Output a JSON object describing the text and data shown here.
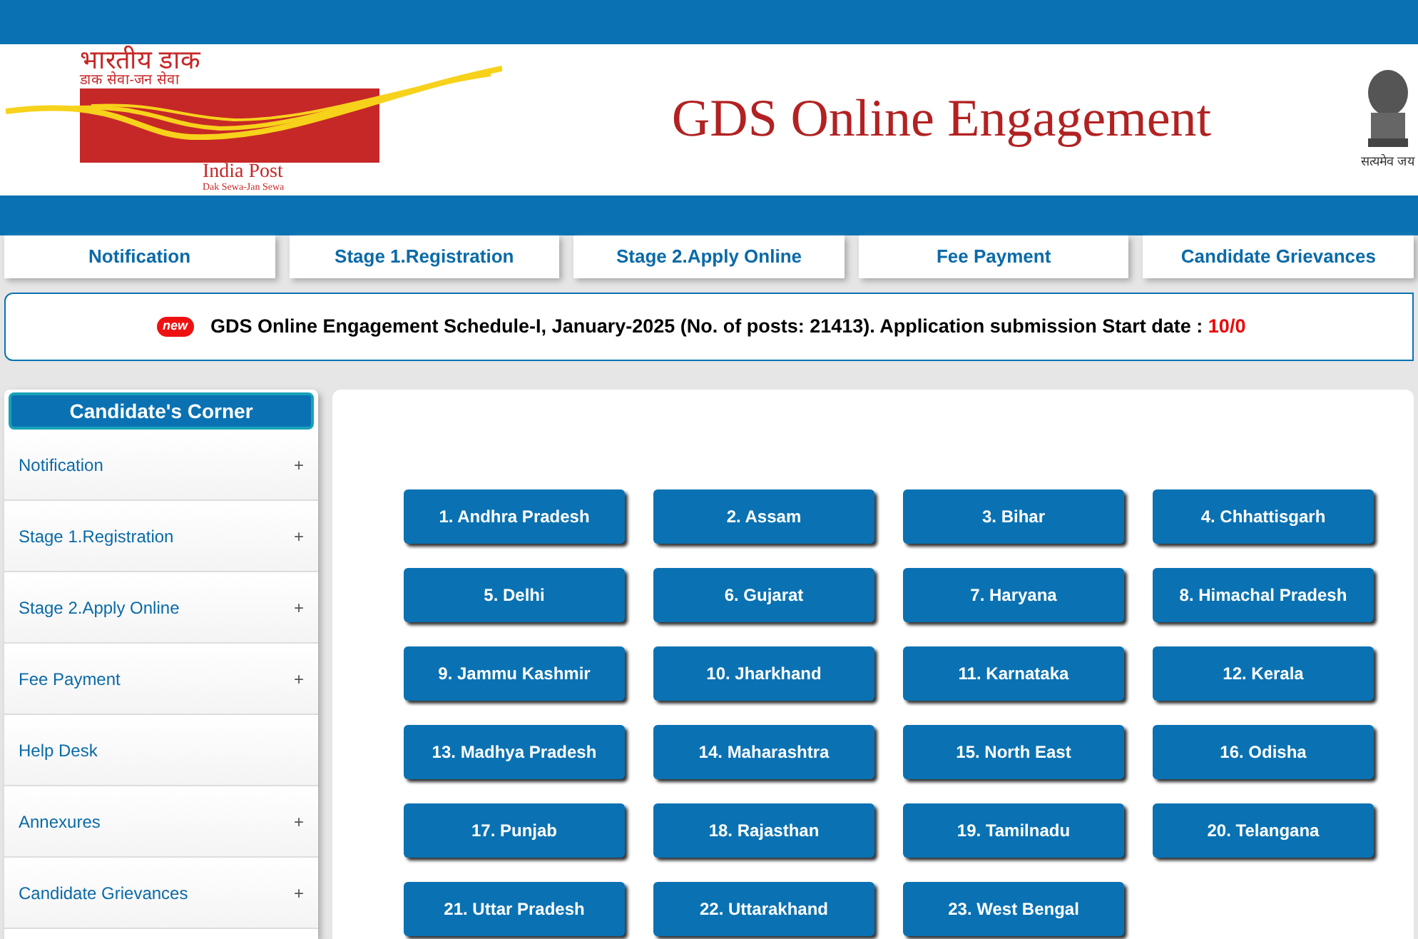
{
  "header": {
    "logo": {
      "hindi_title": "भारतीय डाक",
      "hindi_tagline": "डाक सेवा-जन सेवा",
      "name": "India Post",
      "tagline": "Dak Sewa-Jan Sewa"
    },
    "title": "GDS Online Engagement",
    "emblem_motto": "सत्यमेव जय"
  },
  "nav_tabs": [
    {
      "label": "Notification"
    },
    {
      "label": "Stage 1.Registration"
    },
    {
      "label": "Stage 2.Apply Online"
    },
    {
      "label": "Fee Payment"
    },
    {
      "label": "Candidate Grievances"
    }
  ],
  "ticker": {
    "badge": "new",
    "text": "GDS Online Engagement Schedule-I, January-2025 (No. of posts: 21413). Application submission Start date : ",
    "highlight": "10/0"
  },
  "sidebar": {
    "title": "Candidate's Corner",
    "items": [
      {
        "label": "Notification",
        "expandable": true
      },
      {
        "label": "Stage 1.Registration",
        "expandable": true
      },
      {
        "label": "Stage 2.Apply Online",
        "expandable": true
      },
      {
        "label": "Fee Payment",
        "expandable": true
      },
      {
        "label": "Help Desk",
        "expandable": false
      },
      {
        "label": "Annexures",
        "expandable": true
      },
      {
        "label": "Candidate Grievances",
        "expandable": true
      }
    ],
    "expand_symbol": "+"
  },
  "circles": [
    "1. Andhra Pradesh",
    "2. Assam",
    "3. Bihar",
    "4. Chhattisgarh",
    "5. Delhi",
    "6. Gujarat",
    "7. Haryana",
    "8. Himachal Pradesh",
    "9. Jammu Kashmir",
    "10. Jharkhand",
    "11. Karnataka",
    "12. Kerala",
    "13. Madhya Pradesh",
    "14. Maharashtra",
    "15. North East",
    "16. Odisha",
    "17. Punjab",
    "18. Rajasthan",
    "19. Tamilnadu",
    "20. Telangana",
    "21. Uttar Pradesh",
    "22. Uttarakhand",
    "23. West Bengal"
  ]
}
